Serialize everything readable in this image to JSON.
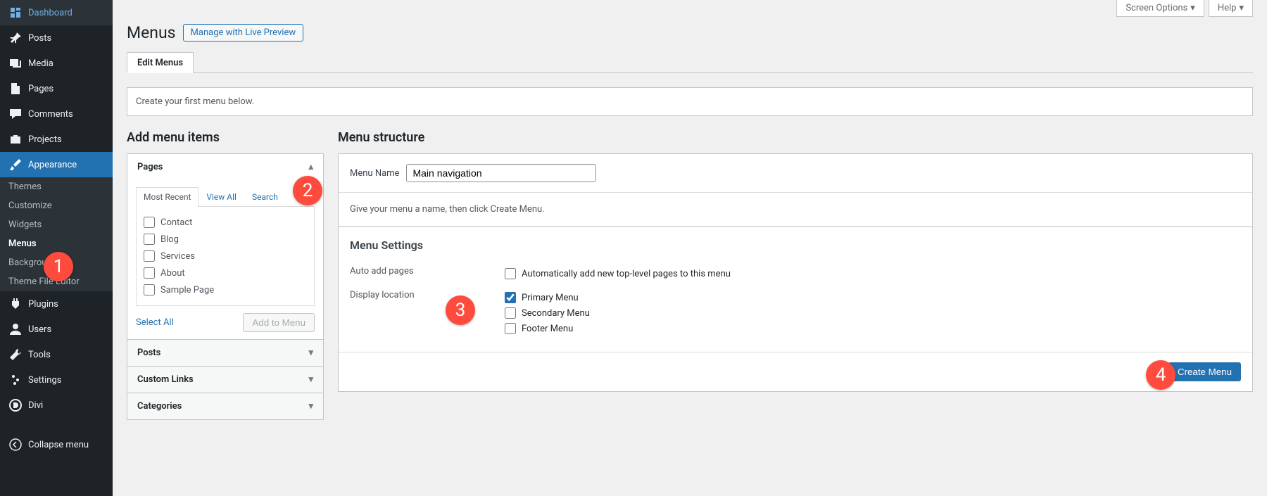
{
  "screenMeta": {
    "screenOptions": "Screen Options",
    "help": "Help"
  },
  "page": {
    "title": "Menus",
    "livePreview": "Manage with Live Preview",
    "tab": "Edit Menus",
    "notice": "Create your first menu below."
  },
  "sidebar": {
    "items": [
      {
        "label": "Dashboard"
      },
      {
        "label": "Posts"
      },
      {
        "label": "Media"
      },
      {
        "label": "Pages"
      },
      {
        "label": "Comments"
      },
      {
        "label": "Projects"
      },
      {
        "label": "Appearance"
      },
      {
        "label": "Plugins"
      },
      {
        "label": "Users"
      },
      {
        "label": "Tools"
      },
      {
        "label": "Settings"
      },
      {
        "label": "Divi"
      }
    ],
    "appearanceSub": [
      "Themes",
      "Customize",
      "Widgets",
      "Menus",
      "Background",
      "Theme File Editor"
    ],
    "collapse": "Collapse menu"
  },
  "left": {
    "title": "Add menu items",
    "pages": "Pages",
    "tabs": {
      "recent": "Most Recent",
      "viewAll": "View All",
      "search": "Search"
    },
    "pageItems": [
      "Contact",
      "Blog",
      "Services",
      "About",
      "Sample Page"
    ],
    "selectAll": "Select All",
    "addToMenu": "Add to Menu",
    "posts": "Posts",
    "custom": "Custom Links",
    "categories": "Categories"
  },
  "right": {
    "title": "Menu structure",
    "menuNameLabel": "Menu Name",
    "menuNameValue": "Main navigation",
    "help": "Give your menu a name, then click Create Menu.",
    "settingsTitle": "Menu Settings",
    "autoAddLabel": "Auto add pages",
    "autoAddOpt": "Automatically add new top-level pages to this menu",
    "displayLabel": "Display location",
    "locations": [
      "Primary Menu",
      "Secondary Menu",
      "Footer Menu"
    ],
    "createMenu": "Create Menu"
  },
  "badges": [
    "1",
    "2",
    "3",
    "4"
  ]
}
